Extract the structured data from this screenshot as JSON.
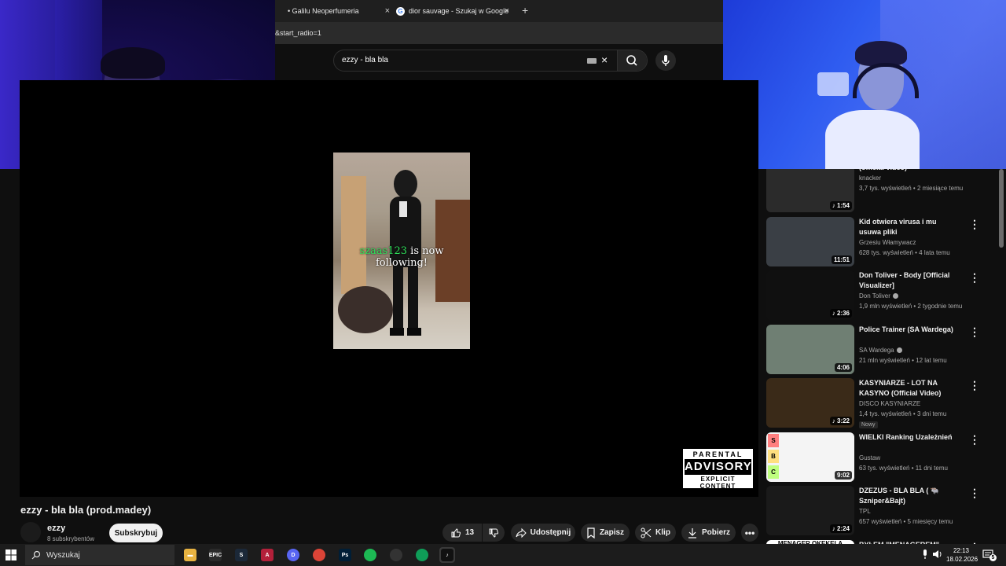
{
  "browser": {
    "tabs": [
      {
        "label": "• Galilu Neoperfumeria",
        "close": "×"
      },
      {
        "label": "dior sauvage - Szukaj w Google",
        "close": "×"
      }
    ],
    "new_tab": "+",
    "address": "&start_radio=1"
  },
  "youtube": {
    "search": {
      "query": "ezzy - bla bla",
      "clear": "×"
    },
    "video": {
      "overlay_user": "szaas123",
      "overlay_text": " is now following!",
      "advisory": {
        "top": "PARENTAL",
        "mid": "ADVISORY",
        "bottom": "EXPLICIT CONTENT"
      },
      "title": "ezzy - bla bla (prod.madey)",
      "channel": "ezzy",
      "subscribers": "8 subskrybentów",
      "subscribe_label": "Subskrybuj",
      "likes": "13",
      "share_label": "Udostępnij",
      "save_label": "Zapisz",
      "clip_label": "Klip",
      "download_label": "Pobierz",
      "more_label": "•••"
    },
    "recommendations": [
      {
        "title": "(official video)",
        "channel": "knacker",
        "meta": "3,7 tys. wyświetleń • 2 miesiące temu",
        "duration": "♪ 1:54",
        "thumb": "#2b2b2b"
      },
      {
        "title": "Kid otwiera virusa i mu usuwa pliki",
        "channel": "Grzesiu Włamywacz",
        "meta": "628 tys. wyświetleń • 4 lata temu",
        "duration": "11:51",
        "thumb": "#3a3f45"
      },
      {
        "title": "Don Toliver - Body [Official Visualizer]",
        "channel": "Don Toliver",
        "meta": "1,9 mln wyświetleń • 2 tygodnie temu",
        "duration": "♪ 2:36",
        "thumb": "#101010"
      },
      {
        "title": "Police Trainer (SA Wardega)",
        "channel": "SA Wardega",
        "meta": "21 mln wyświetleń • 12 lat temu",
        "duration": "4:06",
        "thumb": "#6f7f73"
      },
      {
        "title": "KASYNIARZE - LOT NA KASYNO (Official Video)",
        "channel": "DISCO KASYNIARZE",
        "meta": "1,4 tys. wyświetleń • 3 dni temu",
        "badge": "Nowy",
        "duration": "♪ 3:22",
        "thumb": "#3a2a18"
      },
      {
        "title": "WIELKI Ranking Uzależnień",
        "channel": "Gustaw",
        "meta": "63 tys. wyświetleń • 11 dni temu",
        "duration": "9:02",
        "thumb": "#f4f4f4"
      },
      {
        "title": "DZEZUS - BLA BLA ( 🐃 Szniper&Bajt)",
        "channel": "TPL",
        "meta": "657 wyświetleń • 5 miesięcy temu",
        "duration": "♪ 2:24",
        "thumb": "#1a1a1a"
      },
      {
        "title": "BYŁEM \"MENAGEREM\"",
        "channel": "",
        "meta": "",
        "duration": "",
        "thumb": "#222222",
        "thumb_text": "MENAGER OKEKELA"
      }
    ],
    "tier_labels": [
      "S",
      "B",
      "C"
    ],
    "menu": "⋮"
  },
  "taskbar": {
    "search_placeholder": "Wyszukaj",
    "apps": [
      {
        "name": "file-explorer",
        "glyph": "▬",
        "color": "#e8b341"
      },
      {
        "name": "epic-games",
        "glyph": "EPIC",
        "color": "#2a2a2a"
      },
      {
        "name": "steam",
        "glyph": "S",
        "color": "#1b2838"
      },
      {
        "name": "adobe-app",
        "glyph": "A",
        "color": "#b3203a"
      },
      {
        "name": "discord",
        "glyph": "D",
        "color": "#5865f2"
      },
      {
        "name": "chrome-1",
        "glyph": "",
        "color": "#db4437"
      },
      {
        "name": "photoshop",
        "glyph": "Ps",
        "color": "#001e36"
      },
      {
        "name": "spotify",
        "glyph": "",
        "color": "#1db954"
      },
      {
        "name": "obs",
        "glyph": "",
        "color": "#333333"
      },
      {
        "name": "chrome-2",
        "glyph": "",
        "color": "#0f9d58"
      },
      {
        "name": "tiktok",
        "glyph": "♪",
        "color": "#111111"
      }
    ],
    "time": "22:13",
    "date": "18.02.2026",
    "notifications": "5"
  }
}
